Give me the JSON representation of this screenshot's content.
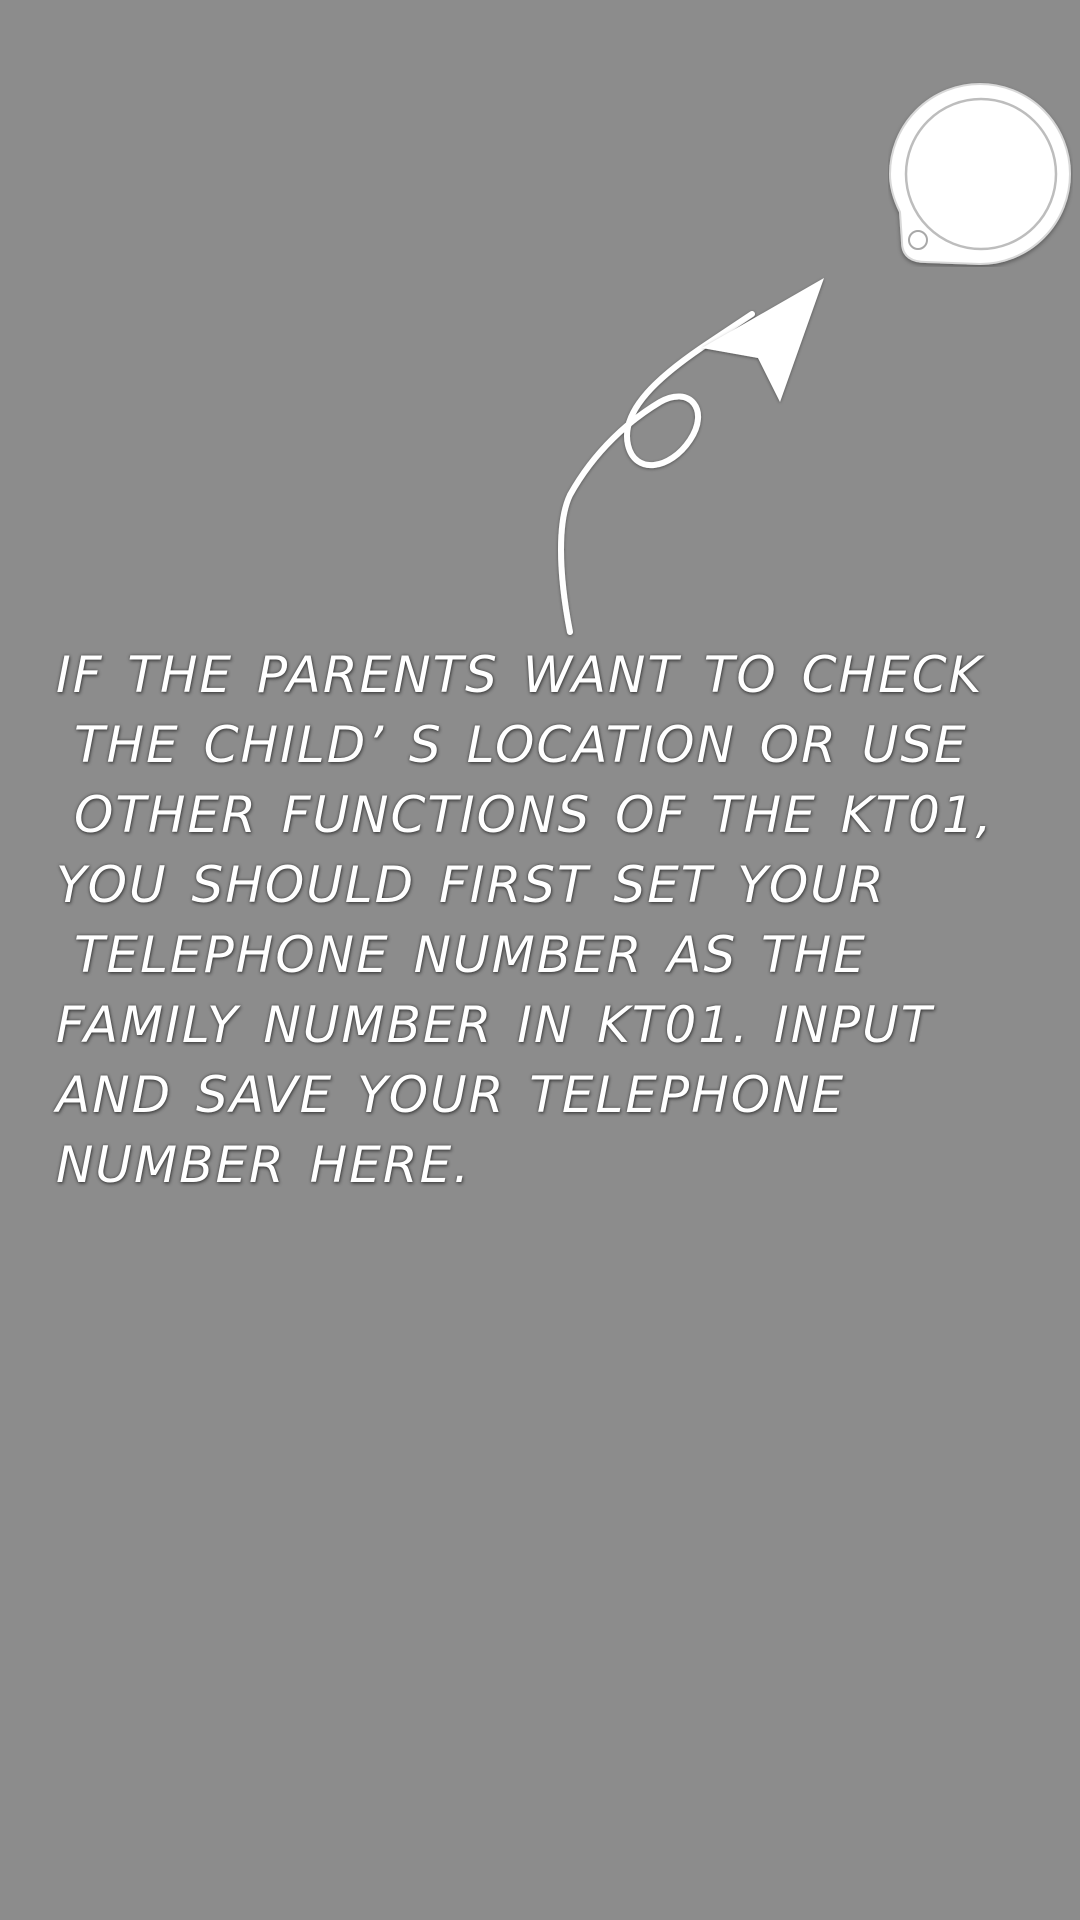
{
  "guide": {
    "lines": [
      "IF THE PARENTS WANT TO CHECK",
      "THE CHILD’ S LOCATION OR USE",
      "OTHER FUNCTIONS OF THE KT01,",
      "YOU SHOULD FIRST SET YOUR",
      "TELEPHONE NUMBER AS THE",
      "FAMILY NUMBER IN KT01. INPUT",
      "AND SAVE YOUR TELEPHONE",
      "NUMBER HERE."
    ]
  },
  "colors": {
    "overlay_bg": "#8c8c8c",
    "foreground": "#ffffff"
  },
  "icons": {
    "target": "chat-bubble-highlight-icon",
    "pointer": "curly-arrow-icon"
  }
}
